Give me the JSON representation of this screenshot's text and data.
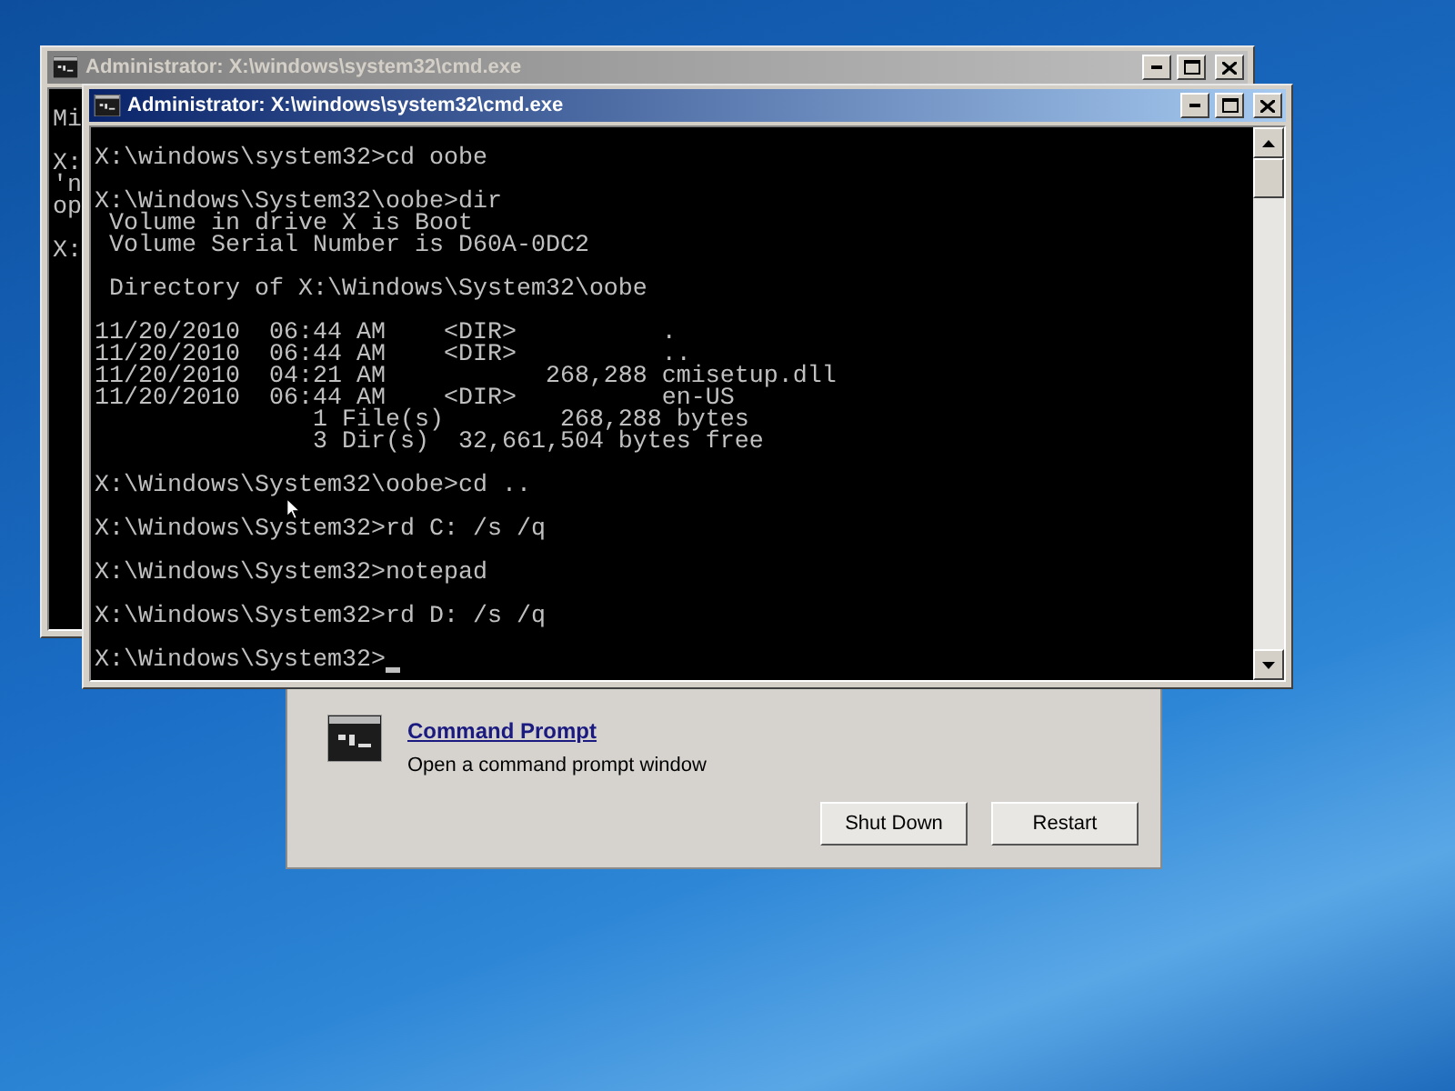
{
  "recovery_dialog": {
    "tool_title": "Command Prompt",
    "tool_description": "Open a command prompt window",
    "buttons": [
      "Shut Down",
      "Restart"
    ]
  },
  "console_windows": [
    {
      "title": "Administrator: X:\\windows\\system32\\cmd.exe",
      "active": false,
      "blocks": [
        [
          "Mi"
        ],
        [
          "X:",
          "'n",
          "op"
        ],
        [
          "X:"
        ]
      ]
    },
    {
      "title": "Administrator: X:\\windows\\system32\\cmd.exe",
      "active": true,
      "blocks": [
        [
          "X:\\windows\\system32>cd oobe"
        ],
        [
          "X:\\Windows\\System32\\oobe>dir",
          " Volume in drive X is Boot",
          " Volume Serial Number is D60A-0DC2"
        ],
        [
          " Directory of X:\\Windows\\System32\\oobe"
        ],
        [
          "11/20/2010  06:44 AM    <DIR>          .",
          "11/20/2010  06:44 AM    <DIR>          ..",
          "11/20/2010  04:21 AM           268,288 cmisetup.dll",
          "11/20/2010  06:44 AM    <DIR>          en-US",
          "               1 File(s)        268,288 bytes",
          "               3 Dir(s)  32,661,504 bytes free"
        ],
        [
          "X:\\Windows\\System32\\oobe>cd .."
        ],
        [
          "X:\\Windows\\System32>rd C: /s /q"
        ],
        [
          "X:\\Windows\\System32>notepad"
        ],
        [
          "X:\\Windows\\System32>rd D: /s /q"
        ],
        [
          "X:\\Windows\\System32>"
        ]
      ]
    }
  ]
}
